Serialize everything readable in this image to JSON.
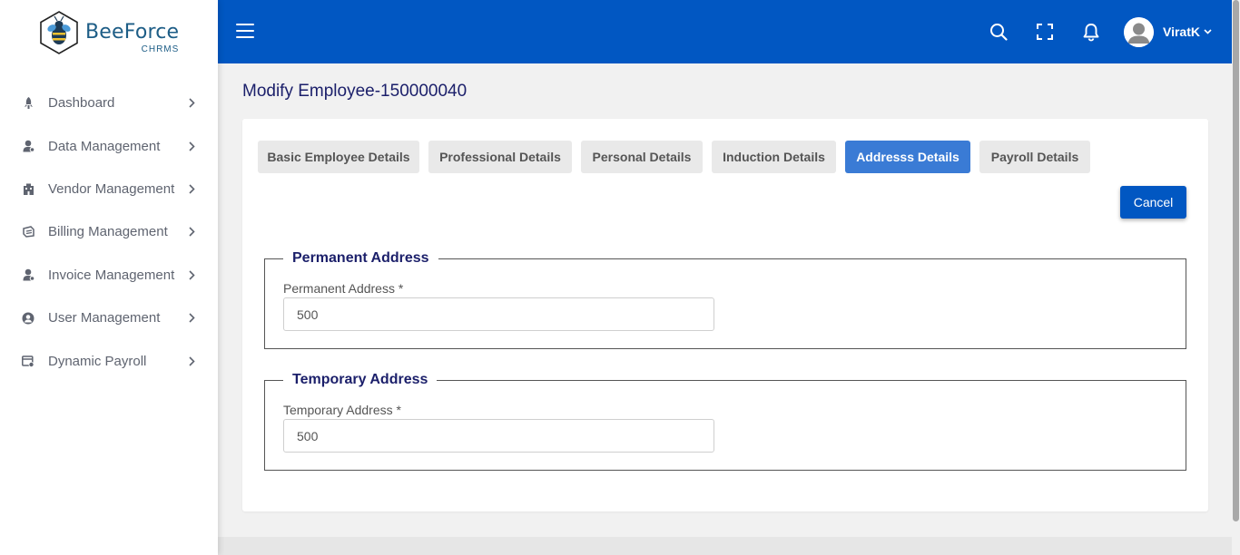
{
  "brand": {
    "name": "BeeForce",
    "sub": "CHRMS"
  },
  "sidebar": {
    "items": [
      {
        "label": "Dashboard",
        "icon": "rocket-icon"
      },
      {
        "label": "Data Management",
        "icon": "user-icon"
      },
      {
        "label": "Vendor Management",
        "icon": "building-icon"
      },
      {
        "label": "Billing Management",
        "icon": "billing-icon"
      },
      {
        "label": "Invoice Management",
        "icon": "user-icon"
      },
      {
        "label": "User Management",
        "icon": "user-circle-icon"
      },
      {
        "label": "Dynamic Payroll",
        "icon": "payroll-icon"
      }
    ]
  },
  "header": {
    "user_name": "ViratK",
    "color": "#0157c2"
  },
  "page": {
    "title": "Modify Employee-150000040"
  },
  "tabs": [
    {
      "label": "Basic Employee Details",
      "active": false
    },
    {
      "label": "Professional Details",
      "active": false
    },
    {
      "label": "Personal Details",
      "active": false
    },
    {
      "label": "Induction Details",
      "active": false
    },
    {
      "label": "Addresss Details",
      "active": true
    },
    {
      "label": "Payroll Details",
      "active": false
    }
  ],
  "actions": {
    "cancel_label": "Cancel"
  },
  "permanent": {
    "legend": "Permanent Address",
    "label": "Permanent Address *",
    "value": "500"
  },
  "temporary": {
    "legend": "Temporary Address",
    "label": "Temporary Address *",
    "value": "500"
  }
}
